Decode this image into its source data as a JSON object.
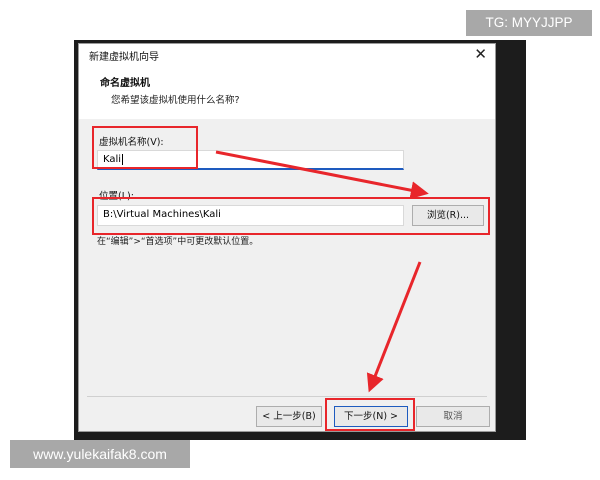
{
  "colors": {
    "dialog_bg": "#f0f0f0",
    "annotation_red": "#e8262b",
    "focus_blue": "#1e5bbf",
    "watermark_bg": "#a8a8a8"
  },
  "dialog": {
    "title": "新建虚拟机向导",
    "close_icon": "close-icon",
    "header": {
      "title": "命名虚拟机",
      "subtitle": "您希望该虚拟机使用什么名称?"
    },
    "vm_name": {
      "label": "虚拟机名称(V):",
      "value": "Kali"
    },
    "location": {
      "label": "位置(L):",
      "value": "B:\\Virtual Machines\\Kali",
      "browse_label": "浏览(R)..."
    },
    "hint": "在“编辑”>“首选项”中可更改默认位置。",
    "buttons": {
      "back": "< 上一步(B)",
      "next": "下一步(N) >",
      "cancel": "取消"
    }
  },
  "watermarks": {
    "tag": "TG: MYYJJPP",
    "site": "www.yulekaifak8.com"
  }
}
